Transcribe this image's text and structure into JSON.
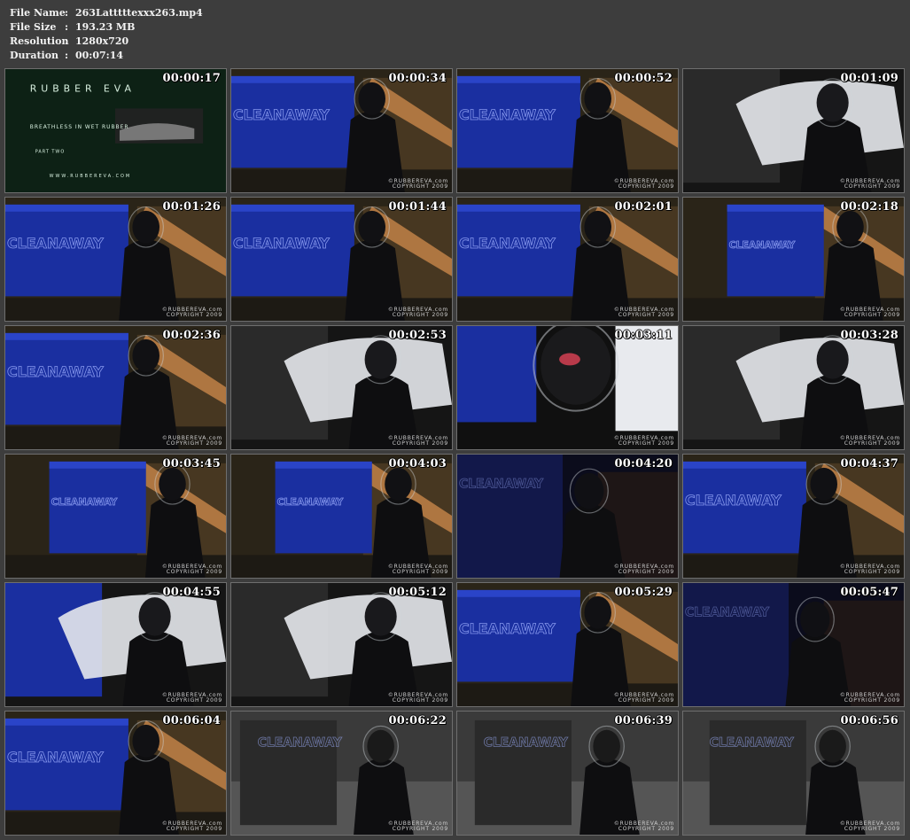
{
  "file_info": [
    {
      "label": "File Name",
      "sep": ":",
      "value": "263Latttttexxx263.mp4"
    },
    {
      "label": "File Size",
      "sep": ":",
      "value": "193.23 MB"
    },
    {
      "label": "Resolution",
      "sep": ":",
      "value": "1280x720"
    },
    {
      "label": "Duration",
      "sep": ":",
      "value": "00:07:14"
    }
  ],
  "watermark": {
    "site": "©RUBBEREVA.com",
    "copyright": "COPYRIGHT 2009"
  },
  "title_card": {
    "brand": "RUBBER EVA",
    "tagline": "BREATHLESS IN WET RUBBER",
    "part": "PART TWO",
    "url": "WWW.RUBBEREVA.COM"
  },
  "bin_label": "CLEANAWAY",
  "colors": {
    "bin_blue": "#1a2fa0",
    "background": "#3d3d3d"
  },
  "thumbnails": [
    {
      "time": "00:00:17",
      "scene": "title"
    },
    {
      "time": "00:00:34",
      "scene": "bin"
    },
    {
      "time": "00:00:52",
      "scene": "bin"
    },
    {
      "time": "00:01:09",
      "scene": "close"
    },
    {
      "time": "00:01:26",
      "scene": "bin"
    },
    {
      "time": "00:01:44",
      "scene": "bin"
    },
    {
      "time": "00:02:01",
      "scene": "bin"
    },
    {
      "time": "00:02:18",
      "scene": "wide"
    },
    {
      "time": "00:02:36",
      "scene": "bin"
    },
    {
      "time": "00:02:53",
      "scene": "close"
    },
    {
      "time": "00:03:11",
      "scene": "face"
    },
    {
      "time": "00:03:28",
      "scene": "close"
    },
    {
      "time": "00:03:45",
      "scene": "wide"
    },
    {
      "time": "00:04:03",
      "scene": "wide"
    },
    {
      "time": "00:04:20",
      "scene": "dark"
    },
    {
      "time": "00:04:37",
      "scene": "bin"
    },
    {
      "time": "00:04:55",
      "scene": "close"
    },
    {
      "time": "00:05:12",
      "scene": "close"
    },
    {
      "time": "00:05:29",
      "scene": "bin"
    },
    {
      "time": "00:05:47",
      "scene": "dark"
    },
    {
      "time": "00:06:04",
      "scene": "bin"
    },
    {
      "time": "00:06:22",
      "scene": "grey"
    },
    {
      "time": "00:06:39",
      "scene": "grey"
    },
    {
      "time": "00:06:56",
      "scene": "grey"
    }
  ]
}
